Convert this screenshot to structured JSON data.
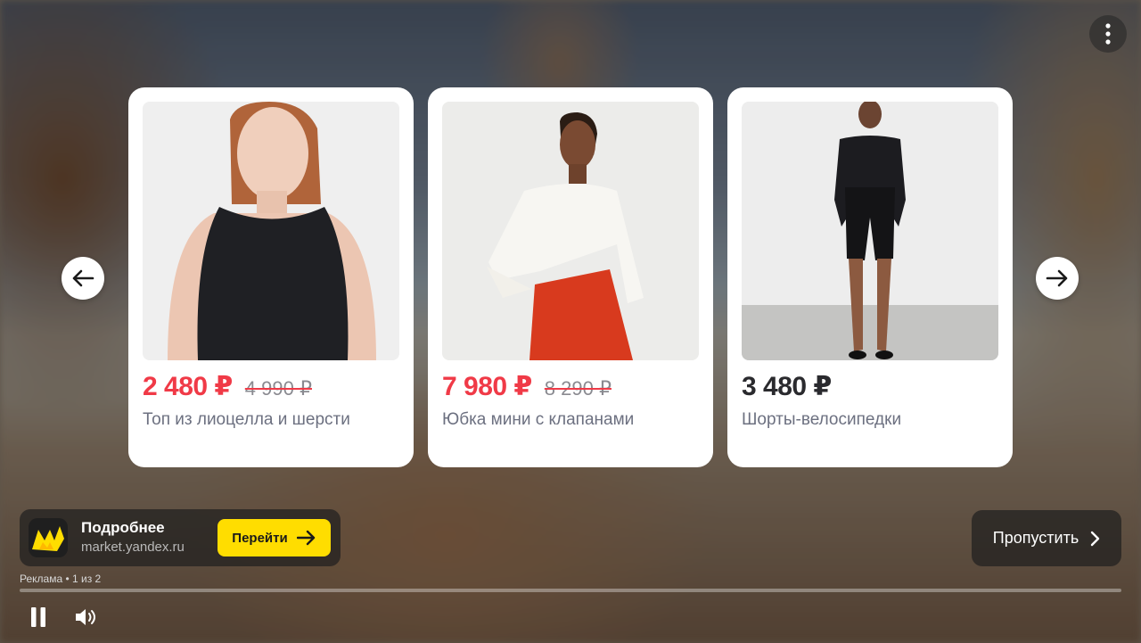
{
  "products": [
    {
      "price": "2 480 ₽",
      "old_price": "4 990 ₽",
      "title": "Топ из лиоцелла и шерсти",
      "discount": true
    },
    {
      "price": "7 980 ₽",
      "old_price": "8 290 ₽",
      "title": "Юбка мини с клапанами",
      "discount": true
    },
    {
      "price": "3 480 ₽",
      "old_price": "",
      "title": "Шорты-велосипедки",
      "discount": false
    }
  ],
  "promo": {
    "title": "Подробнее",
    "domain": "market.yandex.ru",
    "button_label": "Перейти"
  },
  "skip": {
    "label": "Пропустить"
  },
  "ad_label": "Реклама • 1 из 2",
  "progress": 0,
  "icons": {
    "prev": "arrow-left-icon",
    "next": "arrow-right-icon",
    "menu": "more-vertical-icon",
    "pause": "pause-icon",
    "volume": "volume-icon",
    "logo": "yandex-market-logo-icon"
  },
  "colors": {
    "sale_price": "#f03a47",
    "regular_price": "#2a2a2e",
    "cta": "#ffdd00"
  }
}
